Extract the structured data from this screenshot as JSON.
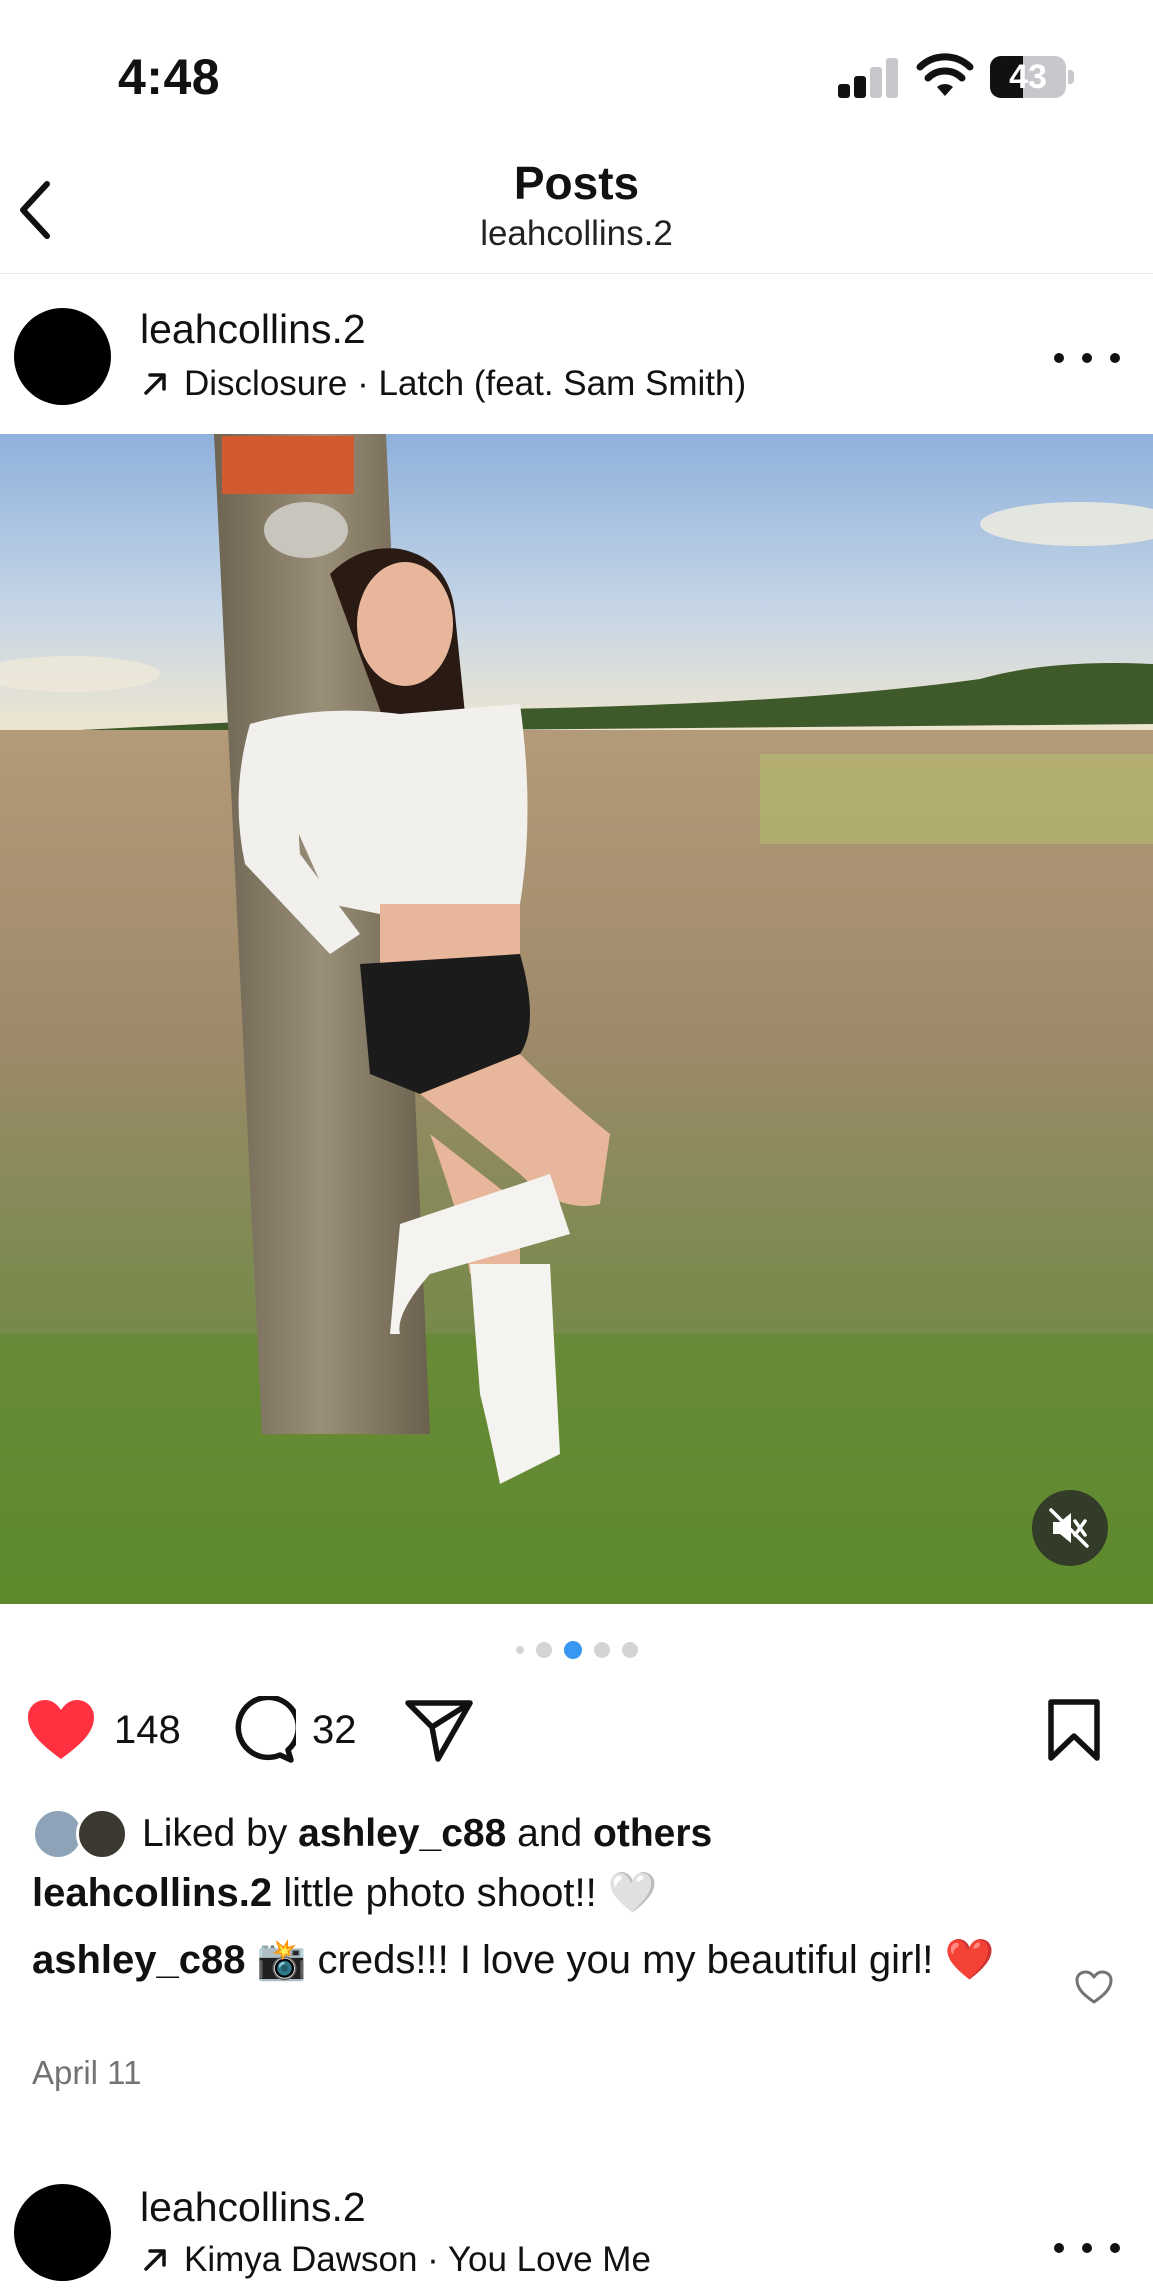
{
  "status_bar": {
    "time": "4:48",
    "battery": "43",
    "battery_level": 0.43,
    "signal_bars_filled": 2
  },
  "header": {
    "title": "Posts",
    "subtitle": "leahcollins.2"
  },
  "posts": [
    {
      "username": "leahcollins.2",
      "audio": "Disclosure · Latch (feat. Sam Smith)",
      "likes": "148",
      "comments_count": "32",
      "liked_by_prefix": "Liked by ",
      "liked_by_user": "ashley_c88",
      "liked_by_and": " and ",
      "liked_by_others": "others",
      "caption_user": "leahcollins.2",
      "caption_text": " little photo shoot!! 🤍",
      "top_comment_user": "ashley_c88",
      "top_comment_text": " 📸 creds!!! I love you my beautiful girl! ❤️",
      "date": "April 11",
      "carousel_count": 5,
      "carousel_active_index": 2
    },
    {
      "username": "leahcollins.2",
      "audio": "Kimya Dawson · You Love Me"
    }
  ],
  "colors": {
    "like_red": "#ff3040",
    "dot_active": "#3897f0",
    "dot_inactive": "#d4d4d4",
    "secondary_text": "#737373"
  },
  "icons": {
    "back": "chevron-left-icon",
    "audio": "arrow-up-right-icon",
    "more": "ellipsis-icon",
    "like": "heart-filled-icon",
    "comment": "comment-bubble-icon",
    "share": "paper-plane-icon",
    "save": "bookmark-icon",
    "mute": "speaker-muted-icon"
  }
}
